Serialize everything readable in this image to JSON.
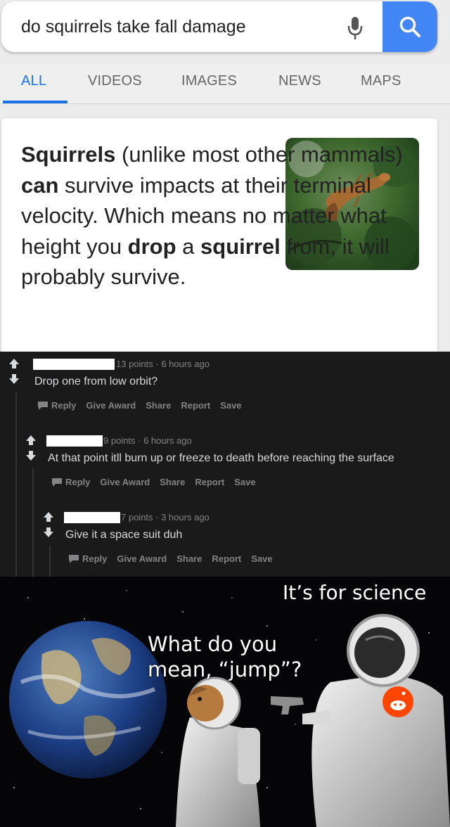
{
  "search": {
    "query": "do squirrels take fall damage",
    "tabs": [
      "ALL",
      "VIDEOS",
      "IMAGES",
      "NEWS",
      "MAPS"
    ],
    "active_tab": "ALL"
  },
  "snippet": {
    "parts": [
      {
        "text": "Squirrels",
        "bold": true
      },
      {
        "text": " (unlike most other mammals) ",
        "bold": false
      },
      {
        "text": "can",
        "bold": true
      },
      {
        "text": " survive impacts at their terminal velocity. Which means no matter what height you ",
        "bold": false
      },
      {
        "text": "drop",
        "bold": true
      },
      {
        "text": " a ",
        "bold": false
      },
      {
        "text": "squirrel",
        "bold": true
      },
      {
        "text": " from, it will probably survive.",
        "bold": false
      }
    ]
  },
  "comments": [
    {
      "meta": "13 points · 6 hours ago",
      "body": "Drop one from low orbit?"
    },
    {
      "meta": "9 points · 6 hours ago",
      "body": "At that point itll burn up or freeze to death before reaching the surface"
    },
    {
      "meta": "7 points · 3 hours ago",
      "body": "Give it a space suit duh"
    }
  ],
  "comment_actions": [
    "Reply",
    "Give Award",
    "Share",
    "Report",
    "Save"
  ],
  "meme": {
    "caption_top": "It’s for science",
    "caption_mid": "What do you\nmean, “jump”?"
  },
  "colors": {
    "google_blue": "#4285f4",
    "tab_active": "#1a73e8",
    "reddit_bg": "#1a1a1b",
    "reddit_meta": "#818384",
    "reddit_orange": "#ff4500"
  }
}
